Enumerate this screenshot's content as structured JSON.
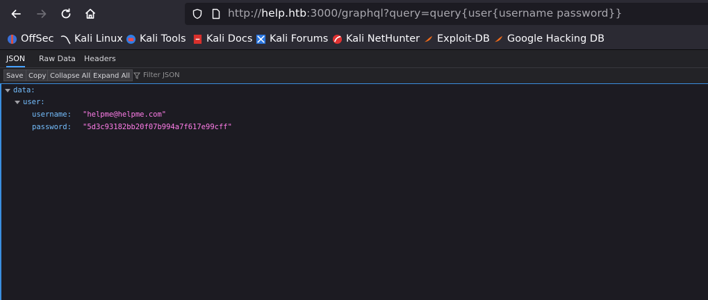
{
  "browser": {
    "url_host": "help.htb",
    "url_prefix": "http://",
    "url_suffix": ":3000/graphql?query=query{user{username password}}"
  },
  "bookmarks": [
    {
      "label": "OffSec",
      "icon": "offsec-icon"
    },
    {
      "label": "Kali Linux",
      "icon": "kali-dragon-icon"
    },
    {
      "label": "Kali Tools",
      "icon": "kali-tools-icon"
    },
    {
      "label": "Kali Docs",
      "icon": "kali-docs-icon"
    },
    {
      "label": "Kali Forums",
      "icon": "kali-forums-icon"
    },
    {
      "label": "Kali NetHunter",
      "icon": "nethunter-icon"
    },
    {
      "label": "Exploit-DB",
      "icon": "exploit-db-icon"
    },
    {
      "label": "Google Hacking DB",
      "icon": "ghdb-icon"
    }
  ],
  "viewer": {
    "tabs": [
      "JSON",
      "Raw Data",
      "Headers"
    ],
    "buttons": [
      "Save",
      "Copy",
      "Collapse All",
      "Expand All"
    ],
    "filter_placeholder": "Filter JSON"
  },
  "json": {
    "data_key": "data:",
    "user_key": "user:",
    "username_key": "username:",
    "username_value": "\"helpme@helpme.com\"",
    "password_key": "password:",
    "password_value": "\"5d3c93182bb20f07b994a7f617e99cff\""
  },
  "colors": {
    "accent": "#45a1ff",
    "key": "#75bfff",
    "string": "#ff7de9"
  }
}
